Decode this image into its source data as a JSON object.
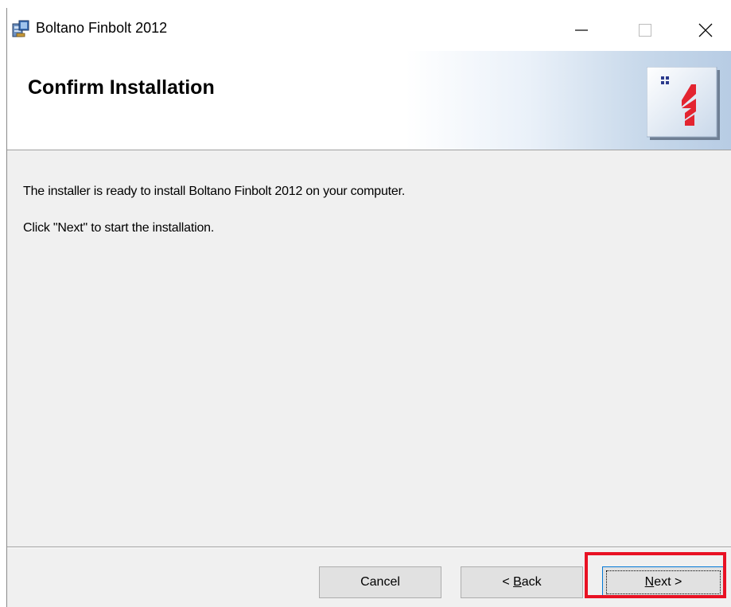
{
  "window": {
    "title": "Boltano Finbolt 2012",
    "icon": "installer-package-icon",
    "controls": {
      "minimize": "minimize-icon",
      "maximize": "maximize-icon",
      "close": "close-icon"
    }
  },
  "banner": {
    "title": "Confirm Installation",
    "logo": "boltano-logo-icon"
  },
  "content": {
    "line1": "The installer is ready to install Boltano Finbolt 2012 on your computer.",
    "line2": "Click \"Next\" to start the installation."
  },
  "buttons": {
    "cancel": "Cancel",
    "back_prefix": "< ",
    "back_mnemonic": "B",
    "back_rest": "ack",
    "next_mnemonic": "N",
    "next_rest": "ext >"
  },
  "colors": {
    "highlight": "#e81123",
    "logo_red": "#e32430",
    "logo_blue": "#2b3a8c",
    "focus_border": "#0078d7"
  }
}
